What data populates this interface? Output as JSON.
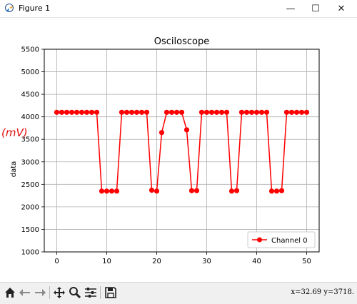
{
  "window": {
    "title": "Figure 1",
    "controls": {
      "minimize": "—",
      "maximize": "☐",
      "close": "✕"
    }
  },
  "chart_data": {
    "type": "line",
    "title": "Osciloscope",
    "xlabel": "",
    "ylabel": "data",
    "annotation": "(mV)",
    "xlim": [
      -2.5,
      52.5
    ],
    "ylim": [
      1000,
      5500
    ],
    "xticks": [
      0,
      10,
      20,
      30,
      40,
      50
    ],
    "yticks": [
      1000,
      1500,
      2000,
      2500,
      3000,
      3500,
      4000,
      4500,
      5000,
      5500
    ],
    "grid": true,
    "legend_position": "lower right",
    "series": [
      {
        "name": "Channel 0",
        "color": "#ff0000",
        "marker": "circle",
        "x": [
          0,
          1,
          2,
          3,
          4,
          5,
          6,
          7,
          8,
          9,
          10,
          11,
          12,
          13,
          14,
          15,
          16,
          17,
          18,
          19,
          20,
          21,
          22,
          23,
          24,
          25,
          26,
          27,
          28,
          29,
          30,
          31,
          32,
          33,
          34,
          35,
          36,
          37,
          38,
          39,
          40,
          41,
          42,
          43,
          44,
          45,
          46,
          47,
          48,
          49,
          50
        ],
        "values": [
          4100,
          4100,
          4100,
          4100,
          4100,
          4100,
          4100,
          4100,
          4100,
          2350,
          2350,
          2350,
          2350,
          4100,
          4100,
          4100,
          4100,
          4100,
          4100,
          2370,
          2350,
          3650,
          4100,
          4100,
          4100,
          4100,
          3710,
          2360,
          2360,
          4100,
          4100,
          4100,
          4100,
          4100,
          4100,
          2350,
          2360,
          4100,
          4100,
          4100,
          4100,
          4100,
          4100,
          2350,
          2350,
          2360,
          4100,
          4100,
          4100,
          4100,
          4100
        ]
      }
    ]
  },
  "toolbar": {
    "items": [
      {
        "name": "home-icon",
        "glyph": "⌂"
      },
      {
        "name": "back-arrow-icon",
        "glyph": "←"
      },
      {
        "name": "forward-arrow-icon",
        "glyph": "→"
      },
      {
        "name": "pan-icon",
        "glyph": "✥"
      },
      {
        "name": "zoom-icon",
        "glyph": "🔍"
      },
      {
        "name": "configure-subplots-icon",
        "glyph": "⚙"
      },
      {
        "name": "save-icon",
        "glyph": "💾"
      }
    ],
    "coordinates": "x=32.69 y=3718."
  }
}
